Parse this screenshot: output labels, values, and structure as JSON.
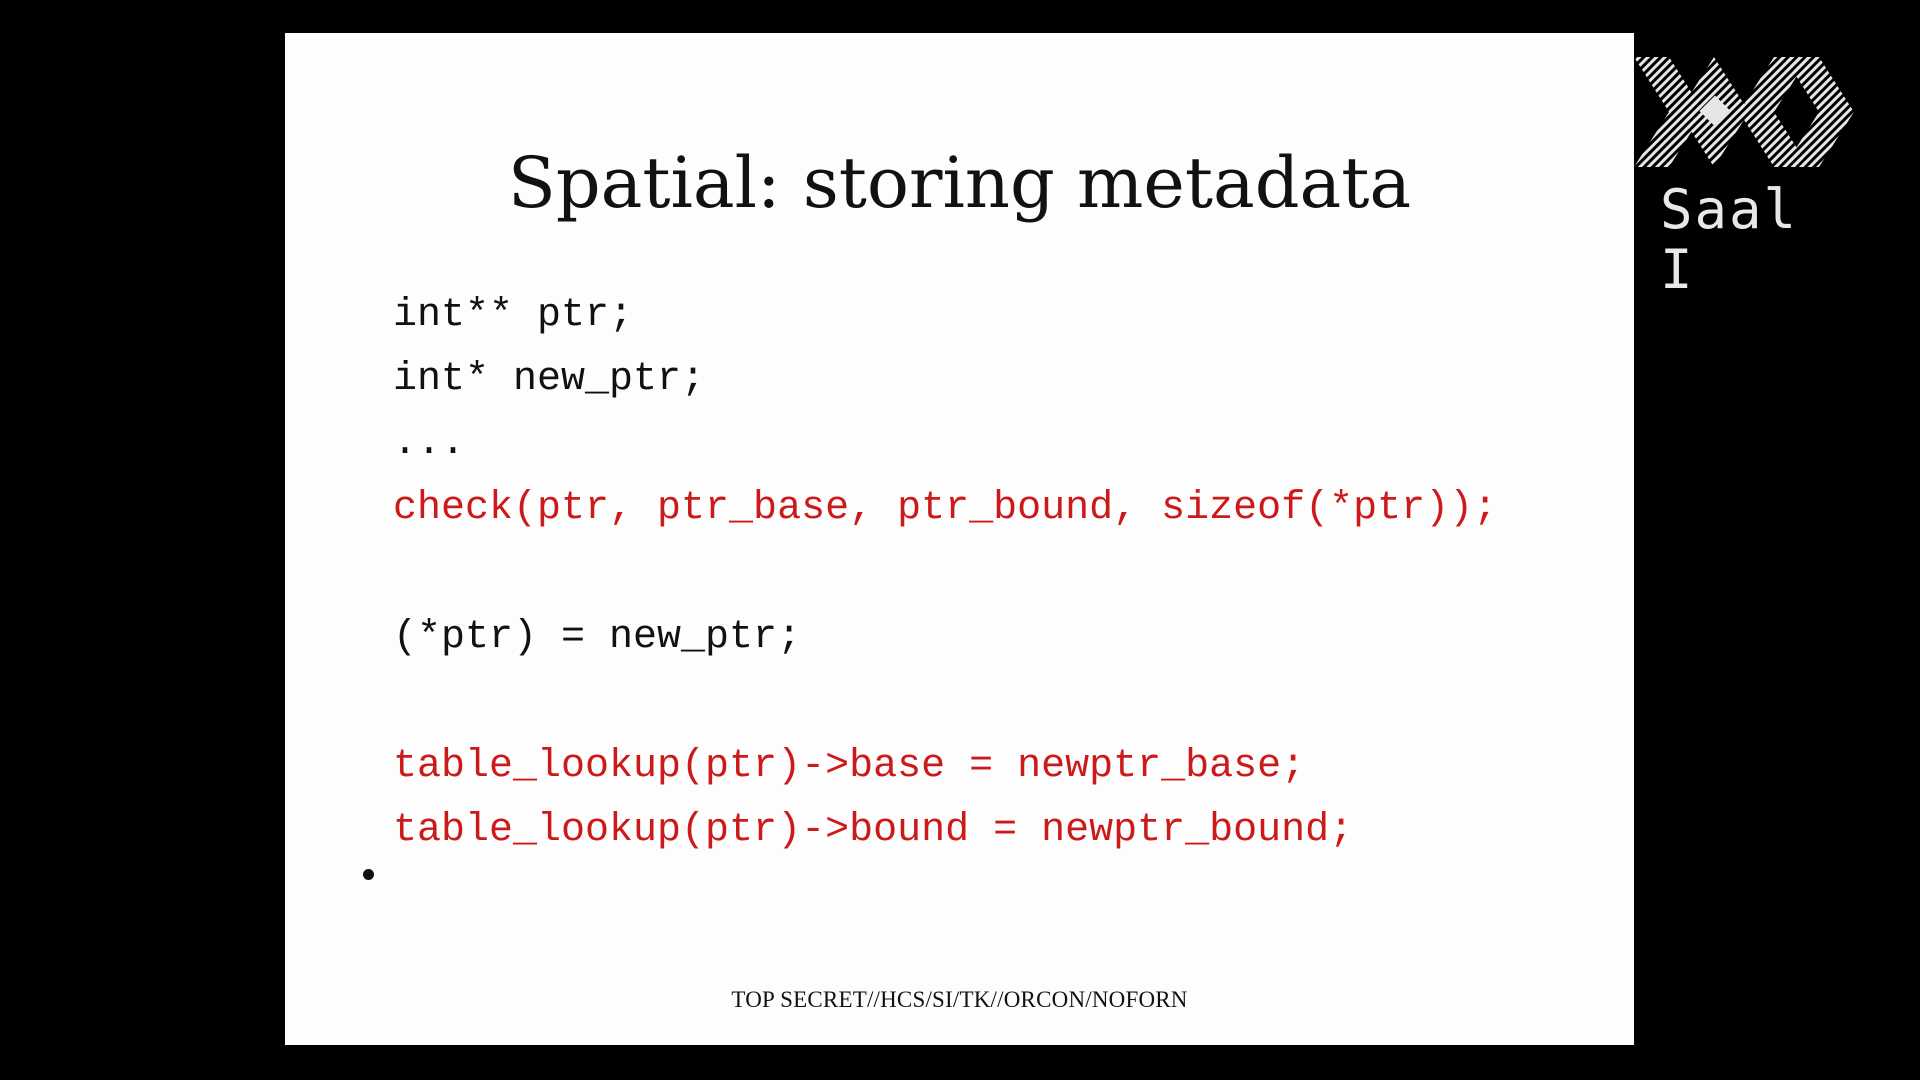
{
  "slide": {
    "title": "Spatial: storing metadata",
    "code_lines": [
      {
        "text": "int** ptr;",
        "highlight": false
      },
      {
        "text": "int* new_ptr;",
        "highlight": false
      },
      {
        "text": "...",
        "highlight": false
      },
      {
        "text": "check(ptr, ptr_base, ptr_bound, sizeof(*ptr));",
        "highlight": true
      },
      {
        "text": "(*ptr) = new_ptr;",
        "highlight": false
      },
      {
        "text": "table_lookup(ptr)->base = newptr_base;",
        "highlight": true
      },
      {
        "text": "table_lookup(ptr)->bound = newptr_bound;",
        "highlight": true
      }
    ],
    "classification": "TOP SECRET//HCS/SI/TK//ORCON/NOFORN"
  },
  "overlay": {
    "logo_icon": "conference-logo-icon",
    "room_label": "Saal I"
  },
  "colors": {
    "background": "#000000",
    "slide_background": "#fdfdfd",
    "text": "#111111",
    "highlight": "#cc1a1a",
    "overlay_text": "#e8e8e8"
  }
}
